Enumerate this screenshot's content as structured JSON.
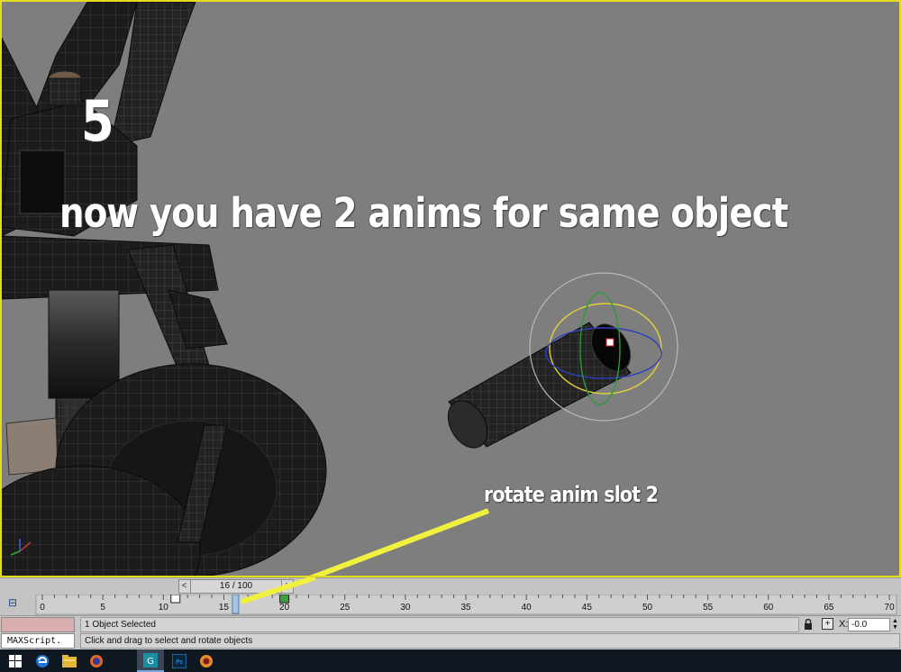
{
  "overlay": {
    "step_number": "5",
    "headline": "now you have 2 anims for same object",
    "annotation": "rotate anim slot 2"
  },
  "timeline": {
    "frame_readout": "16 / 100",
    "prev_glyph": "<",
    "next_glyph": ">",
    "current_frame": 16,
    "total_frames": 100,
    "ticks": [
      "0",
      "5",
      "10",
      "15",
      "20",
      "25",
      "30",
      "35",
      "40",
      "45",
      "50",
      "55",
      "60",
      "65",
      "70"
    ],
    "keyframes": [
      {
        "frame": 11,
        "color": "#ffffff"
      },
      {
        "frame": 20,
        "color": "#3aa040"
      }
    ]
  },
  "status": {
    "maxscript_label": "MAXScript.",
    "selection": "1 Object Selected",
    "prompt": "Click and drag to select and rotate objects",
    "x_label": "X:",
    "x_value": "-0.0"
  },
  "taskbar": {
    "items": [
      "windows-start",
      "edge",
      "file-explorer",
      "firefox",
      "3dsmax",
      "photoshop",
      "other-app"
    ]
  },
  "colors": {
    "viewport_bg": "#7e7e7e",
    "viewport_border": "#e6dc1e",
    "annotation_line": "#f0f040",
    "taskbar": "#0f1720"
  }
}
